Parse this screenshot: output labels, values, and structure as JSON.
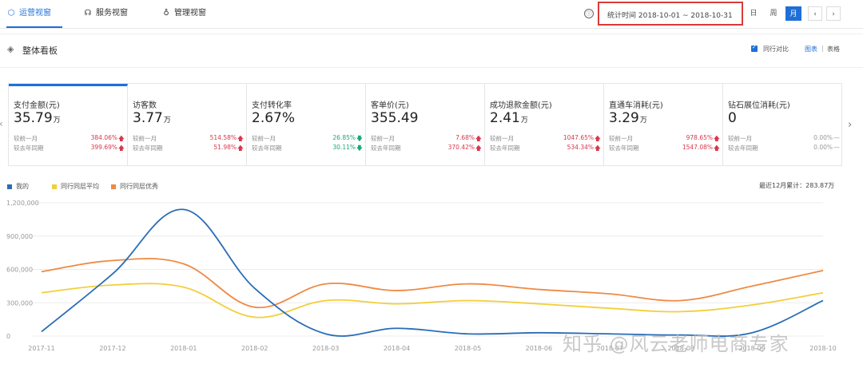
{
  "nav": {
    "tabs": [
      {
        "label": "运营视窗",
        "icon": "hexagon-icon",
        "active": true
      },
      {
        "label": "服务视窗",
        "icon": "headset-icon",
        "active": false
      },
      {
        "label": "管理视窗",
        "icon": "key-icon",
        "active": false
      }
    ],
    "info_icon": "ⓘ",
    "period_text": "统计时间 2018-10-01 ~ 2018-10-31",
    "period_buttons": {
      "day": "日",
      "week": "周",
      "month": "月",
      "prev": "‹",
      "next": "›"
    },
    "highlight_color": "#d93a3a",
    "accent_color": "#1f6fd8"
  },
  "section": {
    "title": "整体看板",
    "compare_label": "同行对比",
    "view_chart": "图表",
    "view_sep": "|",
    "view_table": "表格"
  },
  "metrics": [
    {
      "label": "支付金额(元)",
      "value": "35.79",
      "unit": "万",
      "active": true,
      "cmp1_label": "较前一月",
      "cmp1_value": "384.06%",
      "cmp1_dir": "up",
      "cmp2_label": "较去年同期",
      "cmp2_value": "399.69%",
      "cmp2_dir": "up"
    },
    {
      "label": "访客数",
      "value": "3.77",
      "unit": "万",
      "cmp1_label": "较前一月",
      "cmp1_value": "514.58%",
      "cmp1_dir": "up",
      "cmp2_label": "较去年同期",
      "cmp2_value": "51.98%",
      "cmp2_dir": "up"
    },
    {
      "label": "支付转化率",
      "value": "2.67%",
      "unit": "",
      "cmp1_label": "较前一月",
      "cmp1_value": "26.85%",
      "cmp1_dir": "down",
      "cmp2_label": "较去年同期",
      "cmp2_value": "30.11%",
      "cmp2_dir": "down"
    },
    {
      "label": "客单价(元)",
      "value": "355.49",
      "unit": "",
      "cmp1_label": "较前一月",
      "cmp1_value": "7.68%",
      "cmp1_dir": "up",
      "cmp2_label": "较去年同期",
      "cmp2_value": "370.42%",
      "cmp2_dir": "up"
    },
    {
      "label": "成功退款金额(元)",
      "value": "2.41",
      "unit": "万",
      "cmp1_label": "较前一月",
      "cmp1_value": "1047.65%",
      "cmp1_dir": "up",
      "cmp2_label": "较去年同期",
      "cmp2_value": "534.34%",
      "cmp2_dir": "up"
    },
    {
      "label": "直通车消耗(元)",
      "value": "3.29",
      "unit": "万",
      "cmp1_label": "较前一月",
      "cmp1_value": "978.65%",
      "cmp1_dir": "up",
      "cmp2_label": "较去年同期",
      "cmp2_value": "1547.08%",
      "cmp2_dir": "up"
    },
    {
      "label": "钻石展位消耗(元)",
      "value": "0",
      "unit": "",
      "cmp1_label": "较前一月",
      "cmp1_value": "0.00%",
      "cmp1_dir": "flat",
      "cmp2_label": "较去年同期",
      "cmp2_value": "0.00%",
      "cmp2_dir": "flat"
    }
  ],
  "arrows": {
    "up": "🡅",
    "down": "🡇",
    "flat": "—",
    "left": "‹",
    "right": "›"
  },
  "annual_sum": "最近12月累计：283.87万",
  "watermark": "知乎 @风云老师电商专家",
  "chart_data": {
    "type": "line",
    "categories": [
      "2017-11",
      "2017-12",
      "2018-01",
      "2018-02",
      "2018-03",
      "2018-04",
      "2018-05",
      "2018-06",
      "2018-07",
      "2018-08",
      "2018-09",
      "2018-10"
    ],
    "y_ticks": [
      "1,200,000",
      "900,000",
      "600,000",
      "300,000",
      "0"
    ],
    "ylim": [
      0,
      1200000
    ],
    "grid": true,
    "legend_position": "top-left",
    "series": [
      {
        "name": "我的",
        "color": "#2a6db5",
        "values": [
          40000,
          560000,
          1140000,
          430000,
          20000,
          70000,
          20000,
          30000,
          20000,
          10000,
          30000,
          320000
        ]
      },
      {
        "name": "同行同层平均",
        "color": "#f2cf3c",
        "values": [
          390000,
          460000,
          440000,
          170000,
          320000,
          290000,
          320000,
          290000,
          250000,
          220000,
          280000,
          390000
        ]
      },
      {
        "name": "同行同层优秀",
        "color": "#ee8a43",
        "values": [
          580000,
          680000,
          650000,
          260000,
          470000,
          410000,
          470000,
          420000,
          380000,
          320000,
          450000,
          590000
        ]
      }
    ]
  }
}
